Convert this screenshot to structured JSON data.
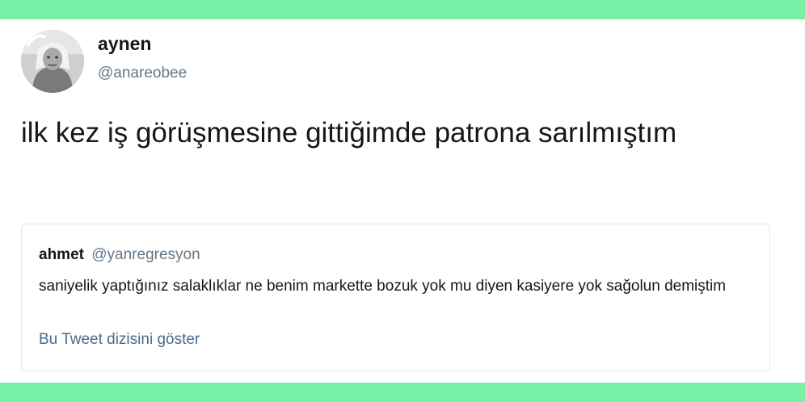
{
  "colors": {
    "accent_bar": "#78f0a6",
    "text_primary": "#14171a",
    "text_secondary": "#657786",
    "link": "#4a6a8a",
    "card_border": "#e1e8ed"
  },
  "tweet": {
    "display_name": "aynen",
    "handle": "@anareobee",
    "avatar_icon": "user-avatar-photo",
    "text": "ilk kez iş görüşmesine gittiğimde patrona sarılmıştım"
  },
  "quoted_tweet": {
    "name": "ahmet",
    "handle": "@yanregresyon",
    "text": "saniyelik yaptığınız salaklıklar ne benim markette bozuk yok mu diyen kasiyere yok sağolun demiştim",
    "show_thread_label": "Bu Tweet dizisini göster"
  }
}
